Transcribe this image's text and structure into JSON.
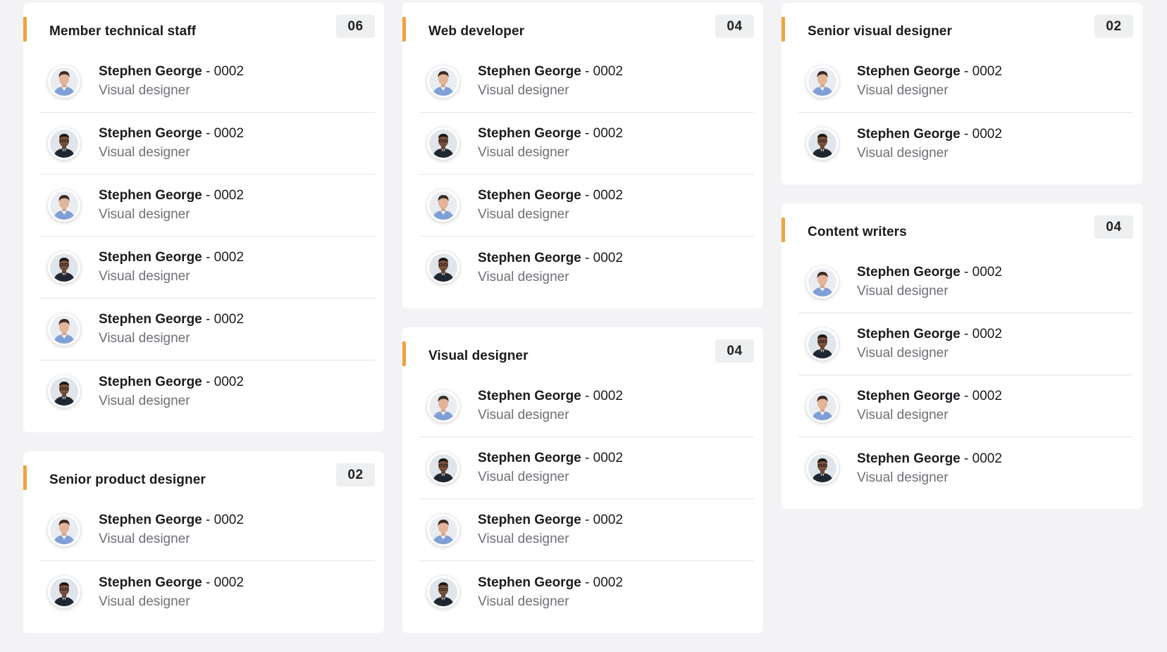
{
  "colors": {
    "accent": "#f0a23c",
    "badge_bg": "#eeeff1",
    "background": "#f3f3f5",
    "card_bg": "#ffffff",
    "muted_text": "#6f6f76"
  },
  "columns": [
    {
      "cards": [
        {
          "title": "Member technical staff",
          "count": "06",
          "members": [
            {
              "name": "Stephen George",
              "separator": " - ",
              "id": "0002",
              "role": "Visual designer",
              "avatar": "avatar-light-shirt"
            },
            {
              "name": "Stephen George",
              "separator": " - ",
              "id": "0002",
              "role": "Visual designer",
              "avatar": "avatar-dark-suit"
            },
            {
              "name": "Stephen George",
              "separator": " - ",
              "id": "0002",
              "role": "Visual designer",
              "avatar": "avatar-light-shirt"
            },
            {
              "name": "Stephen George",
              "separator": " - ",
              "id": "0002",
              "role": "Visual designer",
              "avatar": "avatar-dark-suit"
            },
            {
              "name": "Stephen George",
              "separator": " - ",
              "id": "0002",
              "role": "Visual designer",
              "avatar": "avatar-light-shirt"
            },
            {
              "name": "Stephen George",
              "separator": " - ",
              "id": "0002",
              "role": "Visual designer",
              "avatar": "avatar-dark-suit"
            }
          ]
        },
        {
          "title": "Senior product designer",
          "count": "02",
          "members": [
            {
              "name": "Stephen George",
              "separator": " - ",
              "id": "0002",
              "role": "Visual designer",
              "avatar": "avatar-light-shirt"
            },
            {
              "name": "Stephen George",
              "separator": " - ",
              "id": "0002",
              "role": "Visual designer",
              "avatar": "avatar-dark-suit"
            }
          ]
        }
      ]
    },
    {
      "cards": [
        {
          "title": "Web developer",
          "count": "04",
          "members": [
            {
              "name": "Stephen George",
              "separator": " - ",
              "id": "0002",
              "role": "Visual designer",
              "avatar": "avatar-light-shirt"
            },
            {
              "name": "Stephen George",
              "separator": " - ",
              "id": "0002",
              "role": "Visual designer",
              "avatar": "avatar-dark-suit"
            },
            {
              "name": "Stephen George",
              "separator": " - ",
              "id": "0002",
              "role": "Visual designer",
              "avatar": "avatar-light-shirt"
            },
            {
              "name": "Stephen George",
              "separator": " - ",
              "id": "0002",
              "role": "Visual designer",
              "avatar": "avatar-dark-suit"
            }
          ]
        },
        {
          "title": "Visual designer",
          "count": "04",
          "members": [
            {
              "name": "Stephen George",
              "separator": " - ",
              "id": "0002",
              "role": "Visual designer",
              "avatar": "avatar-light-shirt"
            },
            {
              "name": "Stephen George",
              "separator": " - ",
              "id": "0002",
              "role": "Visual designer",
              "avatar": "avatar-dark-suit"
            },
            {
              "name": "Stephen George",
              "separator": " - ",
              "id": "0002",
              "role": "Visual designer",
              "avatar": "avatar-light-shirt"
            },
            {
              "name": "Stephen George",
              "separator": " - ",
              "id": "0002",
              "role": "Visual designer",
              "avatar": "avatar-dark-suit"
            }
          ]
        }
      ]
    },
    {
      "cards": [
        {
          "title": "Senior visual designer",
          "count": "02",
          "members": [
            {
              "name": "Stephen George",
              "separator": " - ",
              "id": "0002",
              "role": "Visual designer",
              "avatar": "avatar-light-shirt"
            },
            {
              "name": "Stephen George",
              "separator": " - ",
              "id": "0002",
              "role": "Visual designer",
              "avatar": "avatar-dark-suit"
            }
          ]
        },
        {
          "title": "Content writers",
          "count": "04",
          "members": [
            {
              "name": "Stephen George",
              "separator": " - ",
              "id": "0002",
              "role": "Visual designer",
              "avatar": "avatar-light-shirt"
            },
            {
              "name": "Stephen George",
              "separator": " - ",
              "id": "0002",
              "role": "Visual designer",
              "avatar": "avatar-dark-suit"
            },
            {
              "name": "Stephen George",
              "separator": " - ",
              "id": "0002",
              "role": "Visual designer",
              "avatar": "avatar-light-shirt"
            },
            {
              "name": "Stephen George",
              "separator": " - ",
              "id": "0002",
              "role": "Visual designer",
              "avatar": "avatar-dark-suit"
            }
          ]
        }
      ]
    }
  ]
}
